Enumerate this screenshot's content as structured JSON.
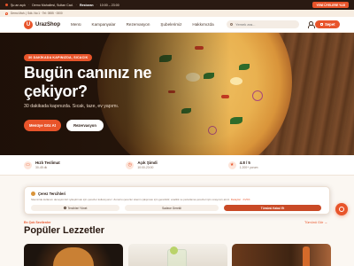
{
  "topbar": {
    "status": "Şu an açık",
    "address": "Demo Mahallesi, Sultan Cad.",
    "hours_label": "Restoran",
    "hours": "10:00 – 23:00",
    "promo": "YENİ ÜYELERE %15"
  },
  "subbar": {
    "location": "Demo Mah. | Sdk. No:1 · Tel: 0555 · 0000"
  },
  "header": {
    "logo_initial": "U",
    "brand": "UrazShop",
    "nav": [
      "Menü",
      "Kampanyalar",
      "Rezervasyon",
      "Şubelerimiz",
      "Hakkımızda"
    ],
    "search_placeholder": "Yemek ara...",
    "cart_label": "Sepet",
    "accent": "#e8542a"
  },
  "hero": {
    "tag": "30 DAKİKADA KAPINIZDA, SICACIK",
    "title": "Bugün canınız ne çekiyor?",
    "subtitle": "30 dakikada kapınızda. Sıcak, taze, ev yapımı.",
    "primary_cta": "Menüye Göz At",
    "secondary_cta": "Rezervasyon"
  },
  "info": [
    {
      "icon": "truck-icon",
      "glyph": "▭",
      "title": "Hızlı Teslimat",
      "sub": "30-45 dk"
    },
    {
      "icon": "clock-icon",
      "glyph": "◷",
      "title": "Açık Şimdi",
      "sub": "10:00-23:00"
    },
    {
      "icon": "star-icon",
      "glyph": "★",
      "title": "4.8 / 5",
      "sub": "1.200+ yorum"
    }
  ],
  "cookie": {
    "title": "Çerez Tercihleri",
    "text": "Sitemizde kullanıcı deneyiminizi iyileştirmek için çerezler kullanıyoruz. Zorunlu çerezler sitenin çalışması için gereklidir; analitik ve pazarlama çerezleri için onayınızı alırız.",
    "link": "Detaylar · KVKK",
    "manage": "Tercihleri Yönet",
    "necessary": "Sadece Gerekli",
    "accept": "Tümünü Kabul Et"
  },
  "popular": {
    "kicker": "En Çok Sevilenler",
    "title": "Popüler Lezzetler",
    "see_all": "Tümünü Gör →"
  }
}
